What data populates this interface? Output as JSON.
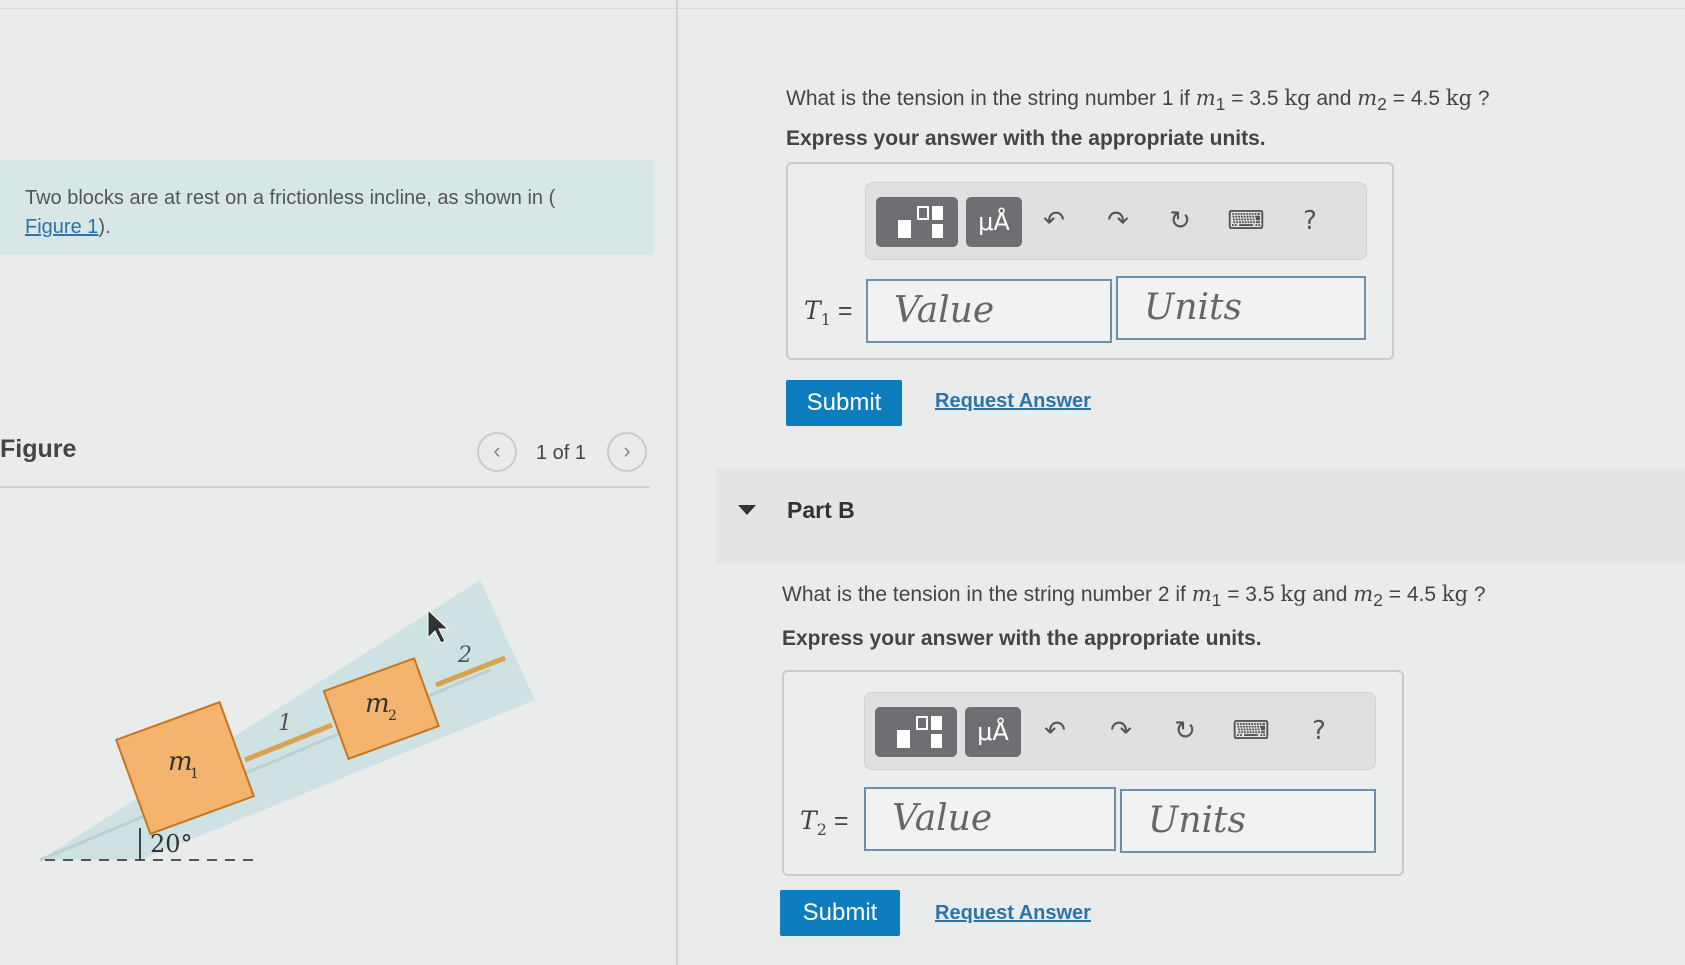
{
  "intro": {
    "text": "Two blocks are at rest on a frictionless incline, as shown in (",
    "link": "Figure 1",
    "after": ")."
  },
  "figure": {
    "title": "Figure",
    "pager": "1 of 1",
    "prev_icon": "chevron-left-icon",
    "next_icon": "chevron-right-icon",
    "labels": {
      "m1": "m",
      "m1_sub": "1",
      "m2": "m",
      "m2_sub": "2",
      "string1": "1",
      "string2": "2",
      "angle": "20°"
    },
    "colors": {
      "block_fill": "#f5b46d",
      "block_stroke": "#c8751f",
      "incline": "#c9dfe0",
      "string": "#d9a24f"
    }
  },
  "partA": {
    "q_pre": "What is the tension in the string number 1 if",
    "m1_sym": "m",
    "m1_sub": "1",
    "eq1": " = 3.5 ",
    "unit1": "kg",
    "and": " and ",
    "m2_sym": "m",
    "m2_sub": "2",
    "eq2": " = 4.5 ",
    "unit2": "kg",
    "q_end": " ?",
    "express": "Express your answer with the appropriate units.",
    "eq_sym": "T",
    "eq_sub": "1",
    "eq_equals": " =",
    "value_placeholder": "Value",
    "units_placeholder": "Units",
    "submit": "Submit",
    "request": "Request Answer"
  },
  "partB": {
    "label": "Part B",
    "q_pre": "What is the tension in the string number 2 if",
    "m1_sym": "m",
    "m1_sub": "1",
    "eq1": " = 3.5 ",
    "unit1": "kg",
    "and": " and ",
    "m2_sym": "m",
    "m2_sub": "2",
    "eq2": " = 4.5 ",
    "unit2": "kg",
    "q_end": " ?",
    "express": "Express your answer with the appropriate units.",
    "eq_sym": "T",
    "eq_sub": "2",
    "eq_equals": " =",
    "value_placeholder": "Value",
    "units_placeholder": "Units",
    "submit": "Submit",
    "request": "Request Answer"
  },
  "toolbar": {
    "templates_icon": "templates-icon",
    "units_label": "μÅ",
    "undo": "↶",
    "redo": "↷",
    "reset": "↻",
    "keyboard": "⌨",
    "help": "?"
  }
}
